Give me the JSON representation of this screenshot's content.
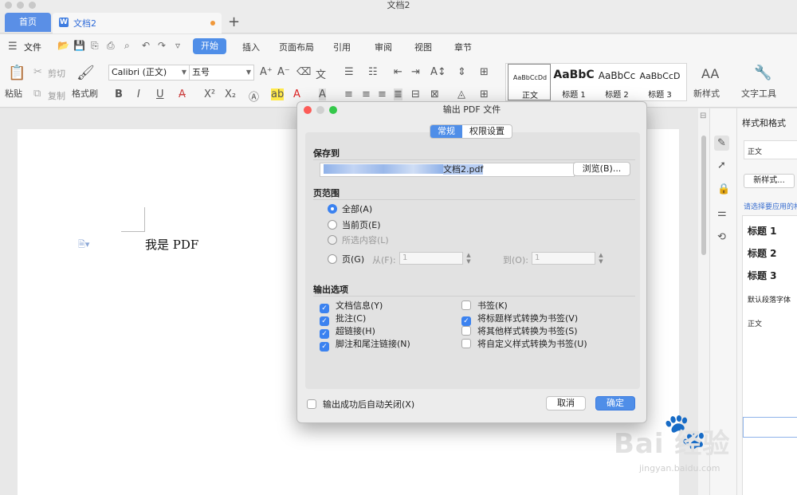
{
  "window": {
    "title": "文档2"
  },
  "tabs": {
    "home": "首页",
    "doc": "文档2",
    "add": "+"
  },
  "menu": {
    "file": "文件",
    "items": [
      "开始",
      "插入",
      "页面布局",
      "引用",
      "审阅",
      "视图",
      "章节"
    ],
    "active": "开始"
  },
  "ribbon": {
    "paste": "粘贴",
    "cut": "剪切",
    "copy": "复制",
    "format_painter": "格式刷",
    "font": "Calibri (正文)",
    "size": "五号",
    "styles": [
      {
        "sample": "AaBbCcDd",
        "name": "正文"
      },
      {
        "sample": "AaBbC",
        "name": "标题 1"
      },
      {
        "sample": "AaBbCc",
        "name": "标题 2"
      },
      {
        "sample": "AaBbCcD",
        "name": "标题 3"
      }
    ],
    "new_style": "新样式",
    "text_tools": "文字工具"
  },
  "document": {
    "text": "我是 PDF"
  },
  "side_panel": {
    "title": "样式和格式",
    "current": "正文",
    "new_style_button": "新样式...",
    "hint": "请选择要应用的格式",
    "items": [
      "标题 1",
      "标题 2",
      "标题 3"
    ],
    "default_font": "默认段落字体",
    "body": "正文"
  },
  "dialog": {
    "title": "输出 PDF 文件",
    "tabs": [
      "常规",
      "权限设置"
    ],
    "save_to_label": "保存到",
    "path_suffix": "文档2.pdf",
    "browse": "浏览(B)...",
    "page_range_label": "页范围",
    "range_all": "全部(A)",
    "range_current": "当前页(E)",
    "range_selection": "所选内容(L)",
    "range_pages": "页(G)",
    "from_label": "从(F):",
    "from_value": "1",
    "to_label": "到(O):",
    "to_value": "1",
    "output_options_label": "输出选项",
    "options_left": [
      {
        "label": "文档信息(Y)",
        "checked": true
      },
      {
        "label": "批注(C)",
        "checked": true
      },
      {
        "label": "超链接(H)",
        "checked": true
      },
      {
        "label": "脚注和尾注链接(N)",
        "checked": true
      }
    ],
    "options_right": [
      {
        "label": "书签(K)",
        "checked": false
      },
      {
        "label": "将标题样式转换为书签(V)",
        "checked": true
      },
      {
        "label": "将其他样式转换为书签(S)",
        "checked": false
      },
      {
        "label": "将自定义样式转换为书签(U)",
        "checked": false
      }
    ],
    "auto_close": "输出成功后自动关闭(X)",
    "cancel": "取消",
    "ok": "确定"
  },
  "watermark": {
    "brand": "Bai 经验",
    "url": "jingyan.baidu.com"
  },
  "colors": {
    "accent": "#4f8ee8",
    "dialog_bg": "#ececec",
    "check_on": "#3b82f0"
  }
}
